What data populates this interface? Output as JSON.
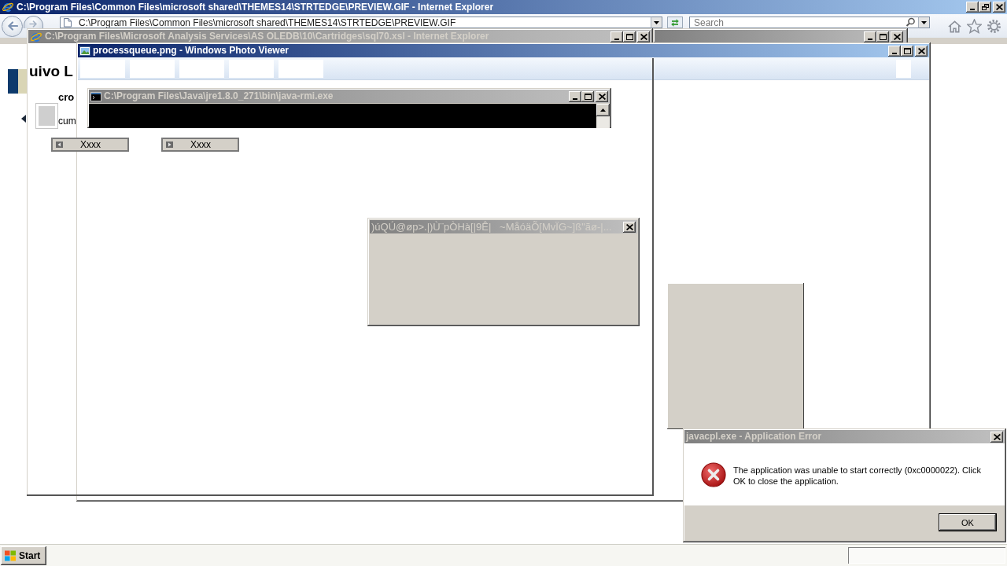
{
  "browser": {
    "title": "C:\\Program Files\\Common Files\\microsoft shared\\THEMES14\\STRTEDGE\\PREVIEW.GIF - Internet Explorer",
    "active": true,
    "address": "C:\\Program Files\\Common Files\\microsoft shared\\THEMES14\\STRTEDGE\\PREVIEW.GIF",
    "search": {
      "placeholder": "Search"
    }
  },
  "second_browser": {
    "title": "C:\\Program Files\\Microsoft Analysis Services\\AS OLEDB\\10\\Cartridges\\sql70.xsl - Internet Explorer",
    "active": false,
    "heading": "uivo L",
    "texts": [
      "cro",
      "cum"
    ],
    "buttons": [
      "Xxxx",
      "Xxxx"
    ]
  },
  "untitled_window": {
    "active": false
  },
  "photo_viewer": {
    "title": "processqueue.png - Windows Photo Viewer",
    "active": true
  },
  "console": {
    "title": "C:\\Program Files\\Java\\jre1.8.0_271\\bin\\java-rmi.exe",
    "active": false
  },
  "garbled_dialog": {
    "title": ")úQÚ@øp>.|)Ù¨pÒHà[|9Ê|   ~MåóäÕ[MvÏG~]ß\"ãø-|...",
    "active": false
  },
  "error_dialog": {
    "title": "javacpl.exe - Application Error",
    "active": false,
    "message": "The application was unable to start correctly (0xc0000022). Click OK to close the application.",
    "button": "OK"
  },
  "taskbar": {
    "start": "Start"
  }
}
